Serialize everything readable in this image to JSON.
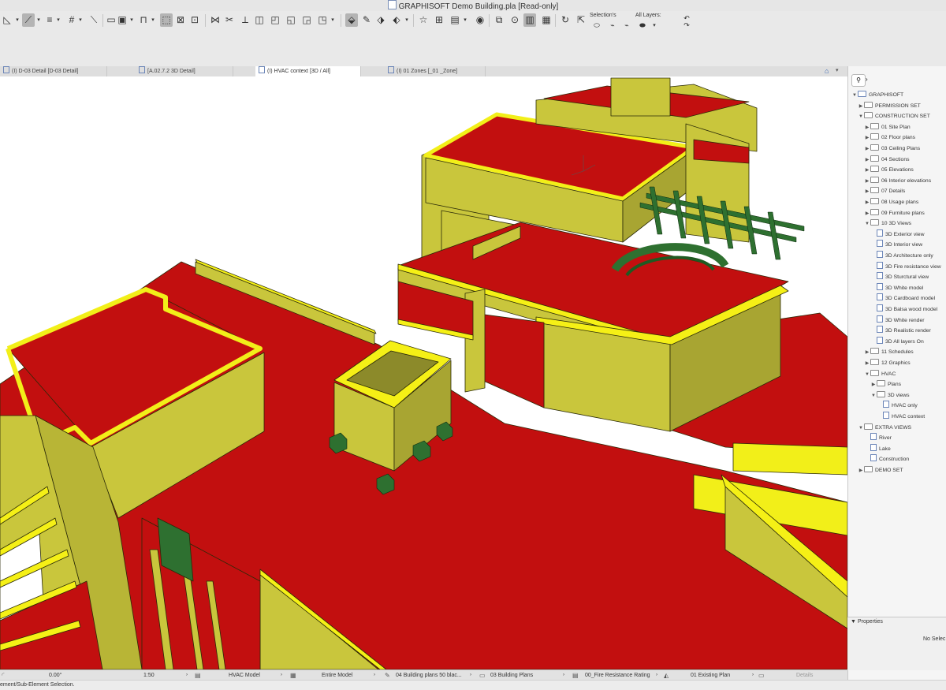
{
  "window": {
    "title": "GRAPHISOFT Demo Building.pla [Read-only]"
  },
  "toolbar": {
    "selection_label": "Selection's",
    "layers_label": "All Layers:"
  },
  "tabs": [
    {
      "label": "(I) D-03 Detail [D-03 Detail]",
      "active": false
    },
    {
      "label": "[A.02.7.2 3D Detail]",
      "active": false
    },
    {
      "label": "(I) HVAC context [3D / All]",
      "active": true
    },
    {
      "label": "(I) 01 Zones [_01 _Zone]",
      "active": false
    }
  ],
  "navigator": {
    "tree": [
      {
        "label": "GRAPHISOFT",
        "level": 0,
        "kind": "root",
        "expanded": true
      },
      {
        "label": "PERMISSION SET",
        "level": 1,
        "kind": "folder",
        "expanded": false
      },
      {
        "label": "CONSTRUCTION SET",
        "level": 1,
        "kind": "folder",
        "expanded": true
      },
      {
        "label": "01 Site Plan",
        "level": 2,
        "kind": "folder",
        "expanded": false
      },
      {
        "label": "02 Floor plans",
        "level": 2,
        "kind": "folder",
        "expanded": false
      },
      {
        "label": "03 Ceiling Plans",
        "level": 2,
        "kind": "folder",
        "expanded": false
      },
      {
        "label": "04 Sections",
        "level": 2,
        "kind": "folder",
        "expanded": false
      },
      {
        "label": "05 Elevations",
        "level": 2,
        "kind": "folder",
        "expanded": false
      },
      {
        "label": "06 Interior elevations",
        "level": 2,
        "kind": "folder",
        "expanded": false
      },
      {
        "label": "07 Details",
        "level": 2,
        "kind": "folder",
        "expanded": false
      },
      {
        "label": "08 Usage plans",
        "level": 2,
        "kind": "folder",
        "expanded": false
      },
      {
        "label": "09 Furniture plans",
        "level": 2,
        "kind": "folder",
        "expanded": false
      },
      {
        "label": "10 3D Views",
        "level": 2,
        "kind": "folder",
        "expanded": true
      },
      {
        "label": "3D Exterior view",
        "level": 3,
        "kind": "view"
      },
      {
        "label": "3D Interior view",
        "level": 3,
        "kind": "view"
      },
      {
        "label": "3D Architecture only",
        "level": 3,
        "kind": "view"
      },
      {
        "label": "3D Fire resistance view",
        "level": 3,
        "kind": "view"
      },
      {
        "label": "3D Sturctural view",
        "level": 3,
        "kind": "view"
      },
      {
        "label": "3D White model",
        "level": 3,
        "kind": "view"
      },
      {
        "label": "3D Cardboard model",
        "level": 3,
        "kind": "view"
      },
      {
        "label": "3D Balsa wood model",
        "level": 3,
        "kind": "view"
      },
      {
        "label": "3D White render",
        "level": 3,
        "kind": "view"
      },
      {
        "label": "3D Realistic render",
        "level": 3,
        "kind": "view"
      },
      {
        "label": "3D All layers On",
        "level": 3,
        "kind": "view"
      },
      {
        "label": "11 Schedules",
        "level": 2,
        "kind": "folder",
        "expanded": false
      },
      {
        "label": "12 Graphics",
        "level": 2,
        "kind": "folder",
        "expanded": false
      },
      {
        "label": "HVAC",
        "level": 2,
        "kind": "folder",
        "expanded": true
      },
      {
        "label": "Plans",
        "level": 3,
        "kind": "folder",
        "expanded": false
      },
      {
        "label": "3D views",
        "level": 3,
        "kind": "folder",
        "expanded": true
      },
      {
        "label": "HVAC only",
        "level": 4,
        "kind": "view"
      },
      {
        "label": "HVAC context",
        "level": 4,
        "kind": "view"
      },
      {
        "label": "EXTRA VIEWS",
        "level": 1,
        "kind": "folder",
        "expanded": true
      },
      {
        "label": "River",
        "level": 2,
        "kind": "view"
      },
      {
        "label": "Lake",
        "level": 2,
        "kind": "view"
      },
      {
        "label": "Construction",
        "level": 2,
        "kind": "view"
      },
      {
        "label": "DEMO SET",
        "level": 1,
        "kind": "folder",
        "expanded": false
      }
    ]
  },
  "properties": {
    "title": "Properties",
    "empty": "No Selec"
  },
  "statusbar": {
    "angle": "0.00°",
    "scale": "1:50",
    "model_view": "HVAC Model",
    "structure": "Entire Model",
    "pen_set": "04 Building plans 50 blac...",
    "graphic_override": "03 Building Plans",
    "renovation": "00_Fire Resistance Rating",
    "phase": "01 Existing Plan",
    "details": "Details"
  },
  "hint": "ement/Sub-Element Selection.",
  "colors": {
    "slab": "#c20f0f",
    "wall": "#c9c63c",
    "wall_top": "#f5f016",
    "wall_dark": "#7d7d1e",
    "duct": "#2e7030"
  }
}
